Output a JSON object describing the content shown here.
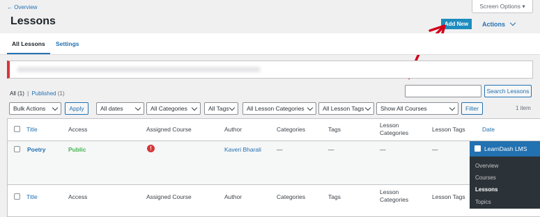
{
  "breadcrumb": "← Overview",
  "screen_options": "Screen Options ▾",
  "page_title": "Lessons",
  "add_new": "Add New",
  "actions": "Actions",
  "tabs": {
    "all": "All Lessons",
    "settings": "Settings"
  },
  "filters": {
    "all": "All",
    "all_count": "(1)",
    "sep": "|",
    "published": "Published",
    "published_count": "(1)"
  },
  "search": {
    "value": "",
    "button": "Search Lessons"
  },
  "toolbar": {
    "bulk_actions": "Bulk Actions",
    "apply": "Apply",
    "dates": "All dates",
    "categories": "All Categories",
    "tags": "All Tags",
    "lesson_categories": "All Lesson Categories",
    "lesson_tags": "All Lesson Tags",
    "courses": "Show All Courses",
    "filter": "Filter",
    "item_count": "1 item"
  },
  "columns": {
    "title": "Title",
    "access": "Access",
    "assigned_course": "Assigned Course",
    "author": "Author",
    "categories": "Categories",
    "tags": "Tags",
    "lesson_categories_1": "Lesson",
    "lesson_categories_2": "Categories",
    "lesson_tags": "Lesson Tags",
    "date": "Date"
  },
  "row": {
    "title": "Poetry",
    "access": "Public",
    "assigned_course_icon": "!",
    "author": "Kaveri Bharali",
    "categories": "—",
    "tags": "—",
    "lesson_categories": "—",
    "lesson_tags": "—"
  },
  "submenu": {
    "header": "LearnDash LMS",
    "items": [
      "Overview",
      "Courses",
      "Lessons",
      "Topics"
    ],
    "active_index": 2
  },
  "colors": {
    "accent": "#2271b1",
    "add_new_bg": "#1e8cbe",
    "public": "#46b450",
    "notice_border": "#d63638",
    "annotation_arrow": "#d0021b",
    "submenu_bg": "#2c3338"
  }
}
